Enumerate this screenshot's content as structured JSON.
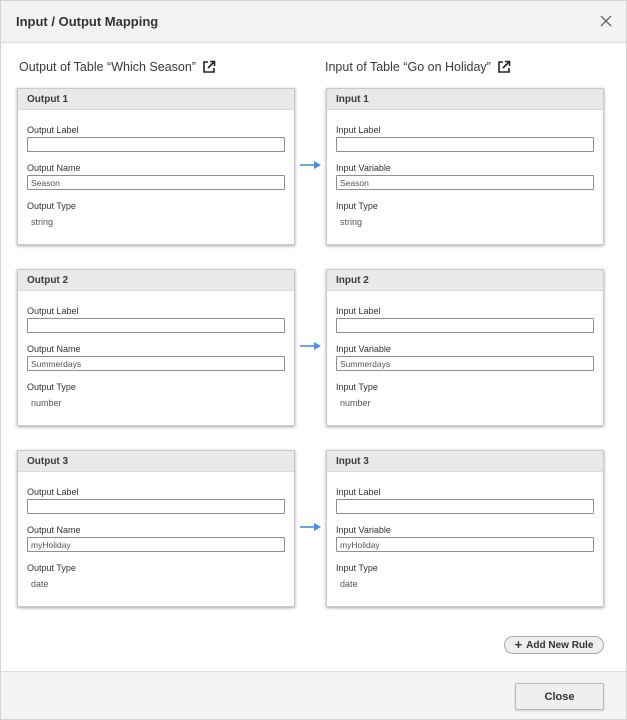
{
  "dialog": {
    "title": "Input / Output Mapping",
    "close_icon": "close-icon"
  },
  "columns": {
    "output_heading": "Output of Table “Which Season”",
    "input_heading": "Input of Table “Go on Holiday”",
    "link_icon": "external-link-icon"
  },
  "labels": {
    "output_label": "Output Label",
    "output_name": "Output Name",
    "output_type": "Output Type",
    "input_label": "Input Label",
    "input_variable": "Input Variable",
    "input_type": "Input Type"
  },
  "rows": [
    {
      "output": {
        "title": "Output 1",
        "label_value": "",
        "name_value": "Season",
        "type": "string"
      },
      "input": {
        "title": "Input 1",
        "label_value": "",
        "variable_value": "Season",
        "type": "string"
      }
    },
    {
      "output": {
        "title": "Output 2",
        "label_value": "",
        "name_value": "Summerdays",
        "type": "number"
      },
      "input": {
        "title": "Input 2",
        "label_value": "",
        "variable_value": "Summerdays",
        "type": "number"
      }
    },
    {
      "output": {
        "title": "Output 3",
        "label_value": "",
        "name_value": "myHoliday",
        "type": "date"
      },
      "input": {
        "title": "Input 3",
        "label_value": "",
        "variable_value": "myHoliday",
        "type": "date"
      }
    }
  ],
  "actions": {
    "add_rule": "Add New Rule",
    "close": "Close"
  },
  "colors": {
    "arrow": "#4a90e2",
    "card_header": "#e9e9e9",
    "border": "#c9c9c9"
  }
}
